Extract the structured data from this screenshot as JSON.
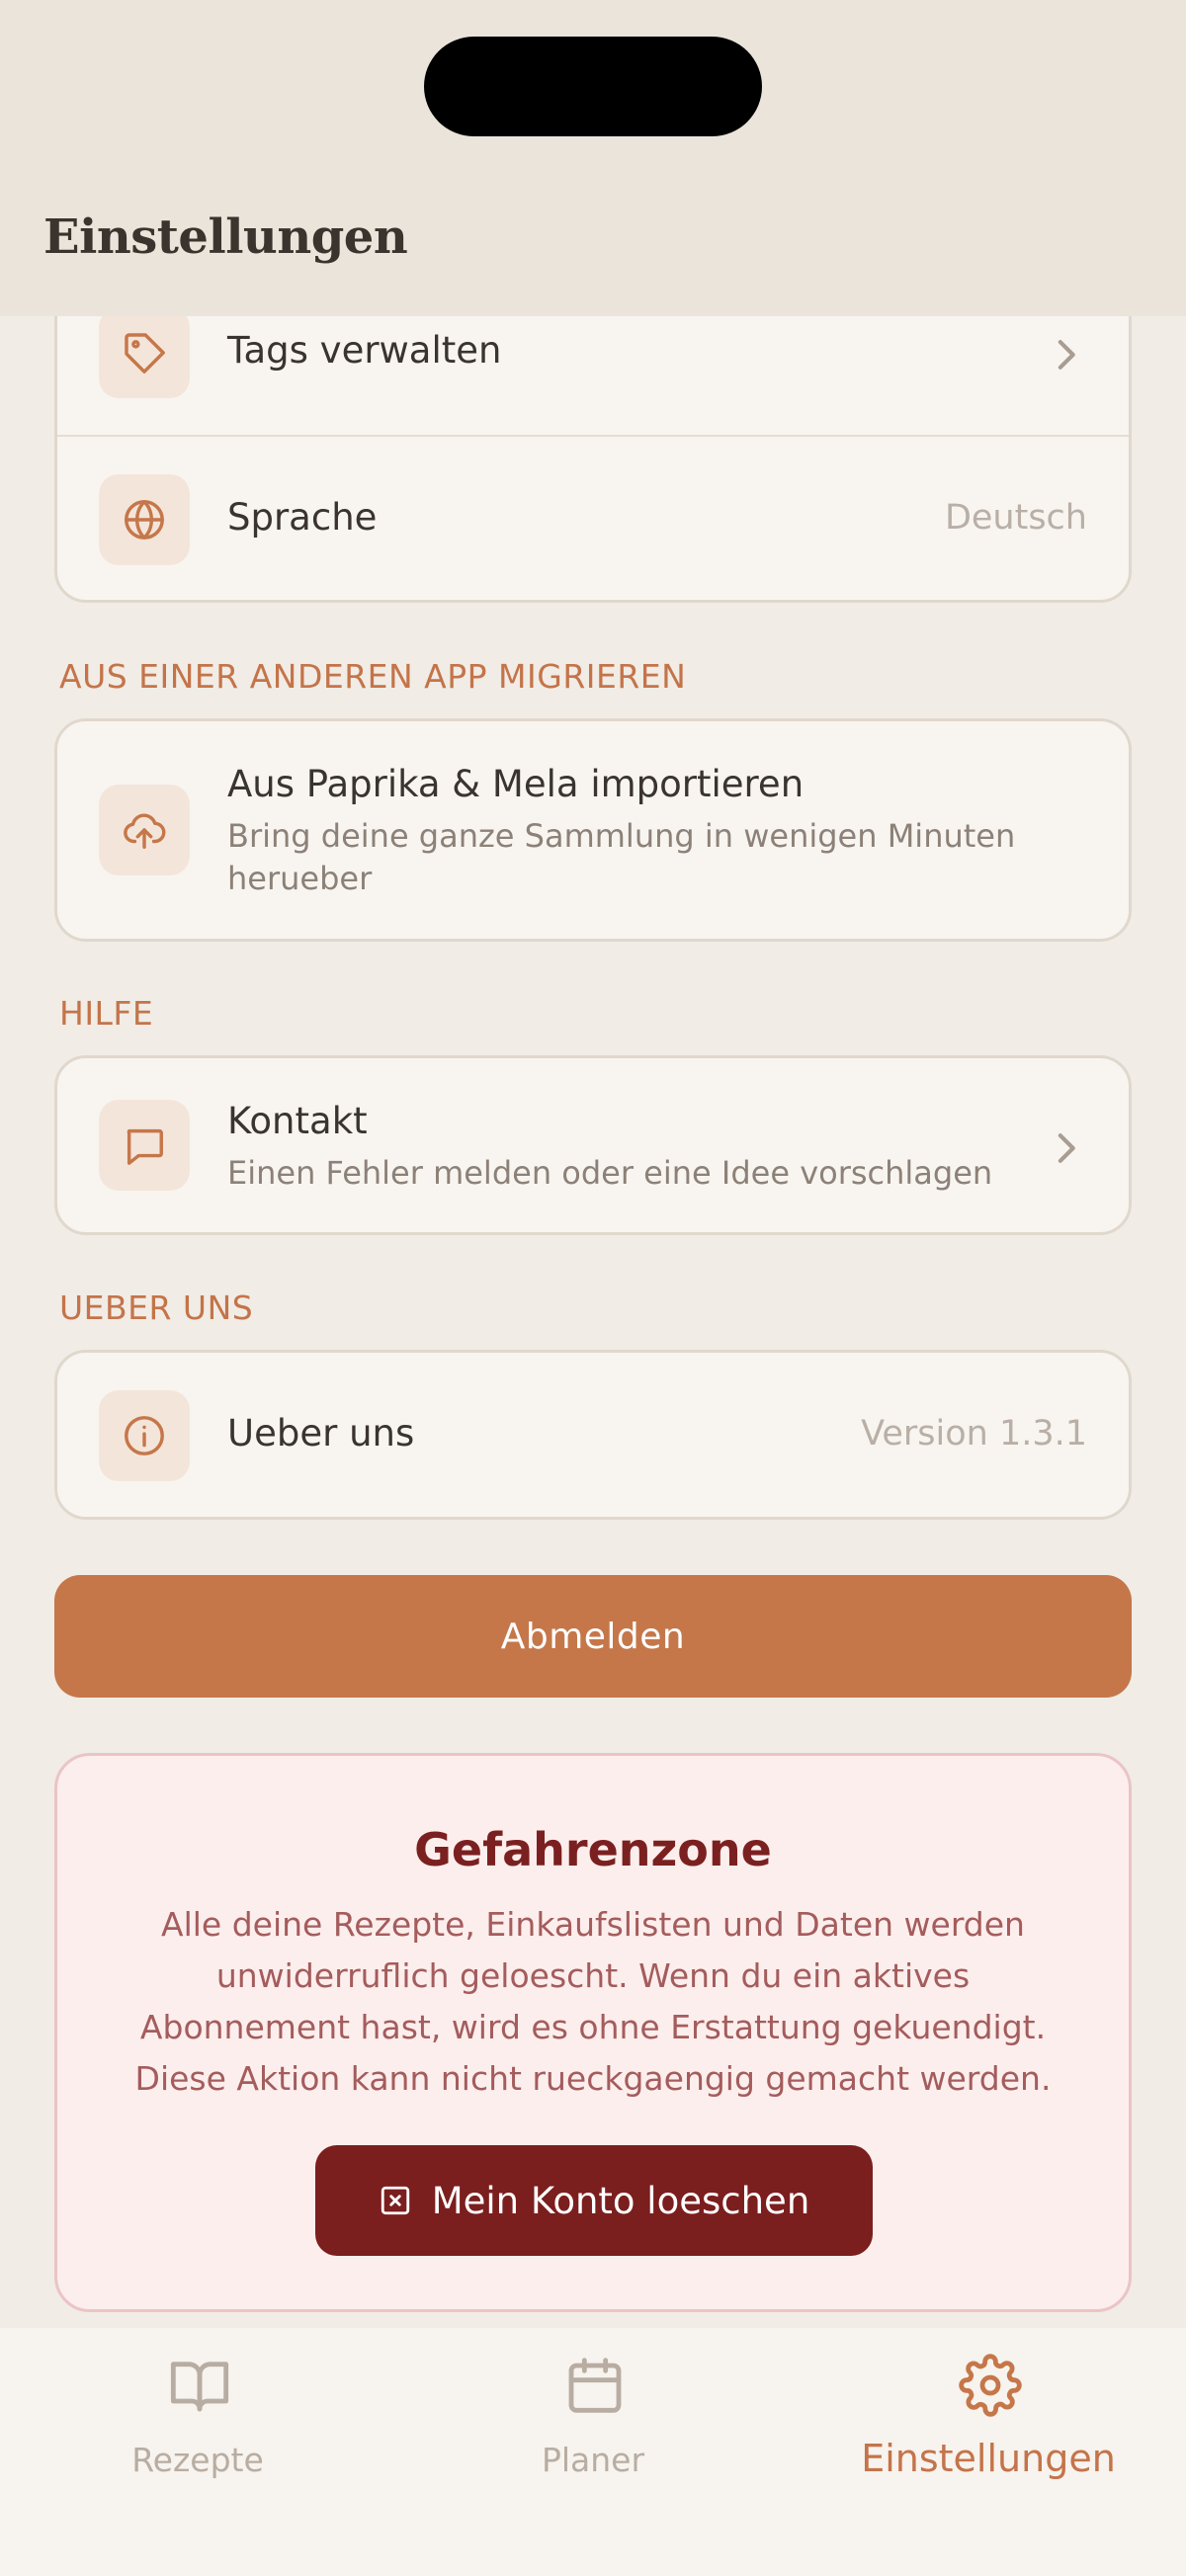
{
  "header": {
    "title": "Einstellungen"
  },
  "general": {
    "tags": {
      "label": "Tags verwalten"
    },
    "language": {
      "label": "Sprache",
      "value": "Deutsch"
    }
  },
  "migrate": {
    "section": "AUS EINER ANDEREN APP MIGRIEREN",
    "label": "Aus Paprika & Mela importieren",
    "sub": "Bring deine ganze Sammlung in wenigen Minuten heruebe​r"
  },
  "help": {
    "section": "HILFE",
    "label": "Kontakt",
    "sub": "Einen Fehler melden oder eine Idee vorschlagen"
  },
  "about": {
    "section": "UEBER UNS",
    "label": "Ueber uns",
    "value": "Version 1.3.1"
  },
  "logout": {
    "label": "Abmelden"
  },
  "danger": {
    "title": "Gefahrenzone",
    "text": "Alle deine Rezepte, Einkaufslisten und Daten werden unwiderruflich geloescht. Wenn du ein aktives Abonnement hast, wird es ohne Erstattung gekuendigt. Diese Aktion kann nicht rueckgaengig gemacht werden.",
    "button": "Mein Konto loeschen"
  },
  "tabs": [
    {
      "label": "Rezepte",
      "icon": "book-open-icon",
      "active": false
    },
    {
      "label": "Planer",
      "icon": "calendar-icon",
      "active": false
    },
    {
      "label": "Einstellungen",
      "icon": "gear-icon",
      "active": true
    }
  ],
  "colors": {
    "accent": "#c5774a",
    "danger": "#7b1e1e",
    "background": "#f1ece5"
  }
}
